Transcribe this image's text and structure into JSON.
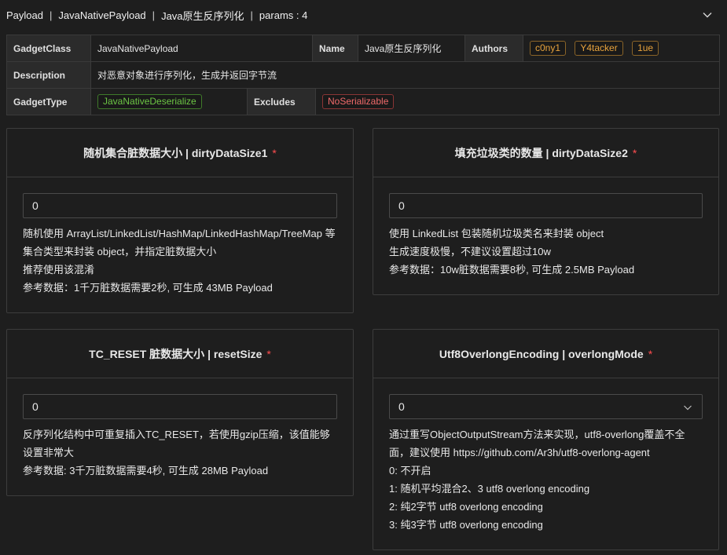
{
  "header": {
    "crumbs": [
      "Payload",
      "JavaNativePayload",
      "Java原生反序列化",
      "params : 4"
    ],
    "separator": "|"
  },
  "meta": {
    "gadget_class_label": "GadgetClass",
    "gadget_class_value": "JavaNativePayload",
    "name_label": "Name",
    "name_value": "Java原生反序列化",
    "authors_label": "Authors",
    "authors": [
      "c0ny1",
      "Y4tacker",
      "1ue"
    ],
    "description_label": "Description",
    "description_value": "对恶意对象进行序列化，生成并返回字节流",
    "gadget_type_label": "GadgetType",
    "gadget_type_value": "JavaNativeDeserialize",
    "excludes_label": "Excludes",
    "excludes_value": "NoSerializable"
  },
  "params": [
    {
      "title": "随机集合脏数据大小 | dirtyDataSize1",
      "required": "*",
      "value": "0",
      "desc": [
        "随机使用 ArrayList/LinkedList/HashMap/LinkedHashMap/TreeMap 等",
        "集合类型来封装 object，并指定脏数据大小",
        "推荐使用该混淆",
        "参考数据：1千万脏数据需要2秒, 可生成 43MB Payload"
      ]
    },
    {
      "title": "填充垃圾类的数量 | dirtyDataSize2",
      "required": "*",
      "value": "0",
      "desc": [
        "使用 LinkedList 包装随机垃圾类名来封装 object",
        "生成速度极慢，不建议设置超过10w",
        "参考数据：10w脏数据需要8秒, 可生成 2.5MB Payload"
      ]
    },
    {
      "title": "TC_RESET 脏数据大小 | resetSize",
      "required": "*",
      "value": "0",
      "desc": [
        "反序列化结构中可重复插入TC_RESET，若使用gzip压缩，该值能够",
        "设置非常大",
        "参考数据: 3千万脏数据需要4秒, 可生成 28MB Payload"
      ]
    },
    {
      "title": "Utf8OverlongEncoding | overlongMode",
      "required": "*",
      "value": "0",
      "desc": [
        "通过重写ObjectOutputStream方法来实现，utf8-overlong覆盖不全",
        "面，建议使用 https://github.com/Ar3h/utf8-overlong-agent",
        "0: 不开启",
        "1: 随机平均混合2、3 utf8 overlong encoding",
        "2: 纯2字节 utf8 overlong encoding",
        "3: 纯3字节 utf8 overlong encoding"
      ]
    }
  ],
  "colors": {
    "background": "#1e1e1e",
    "tag_orange": "#e8a33d",
    "tag_green": "#6cc644",
    "tag_red": "#f06a6a",
    "required": "#ff4d4f"
  },
  "icons": {
    "collapse": "chevron-down-icon",
    "select": "chevron-down-icon"
  }
}
